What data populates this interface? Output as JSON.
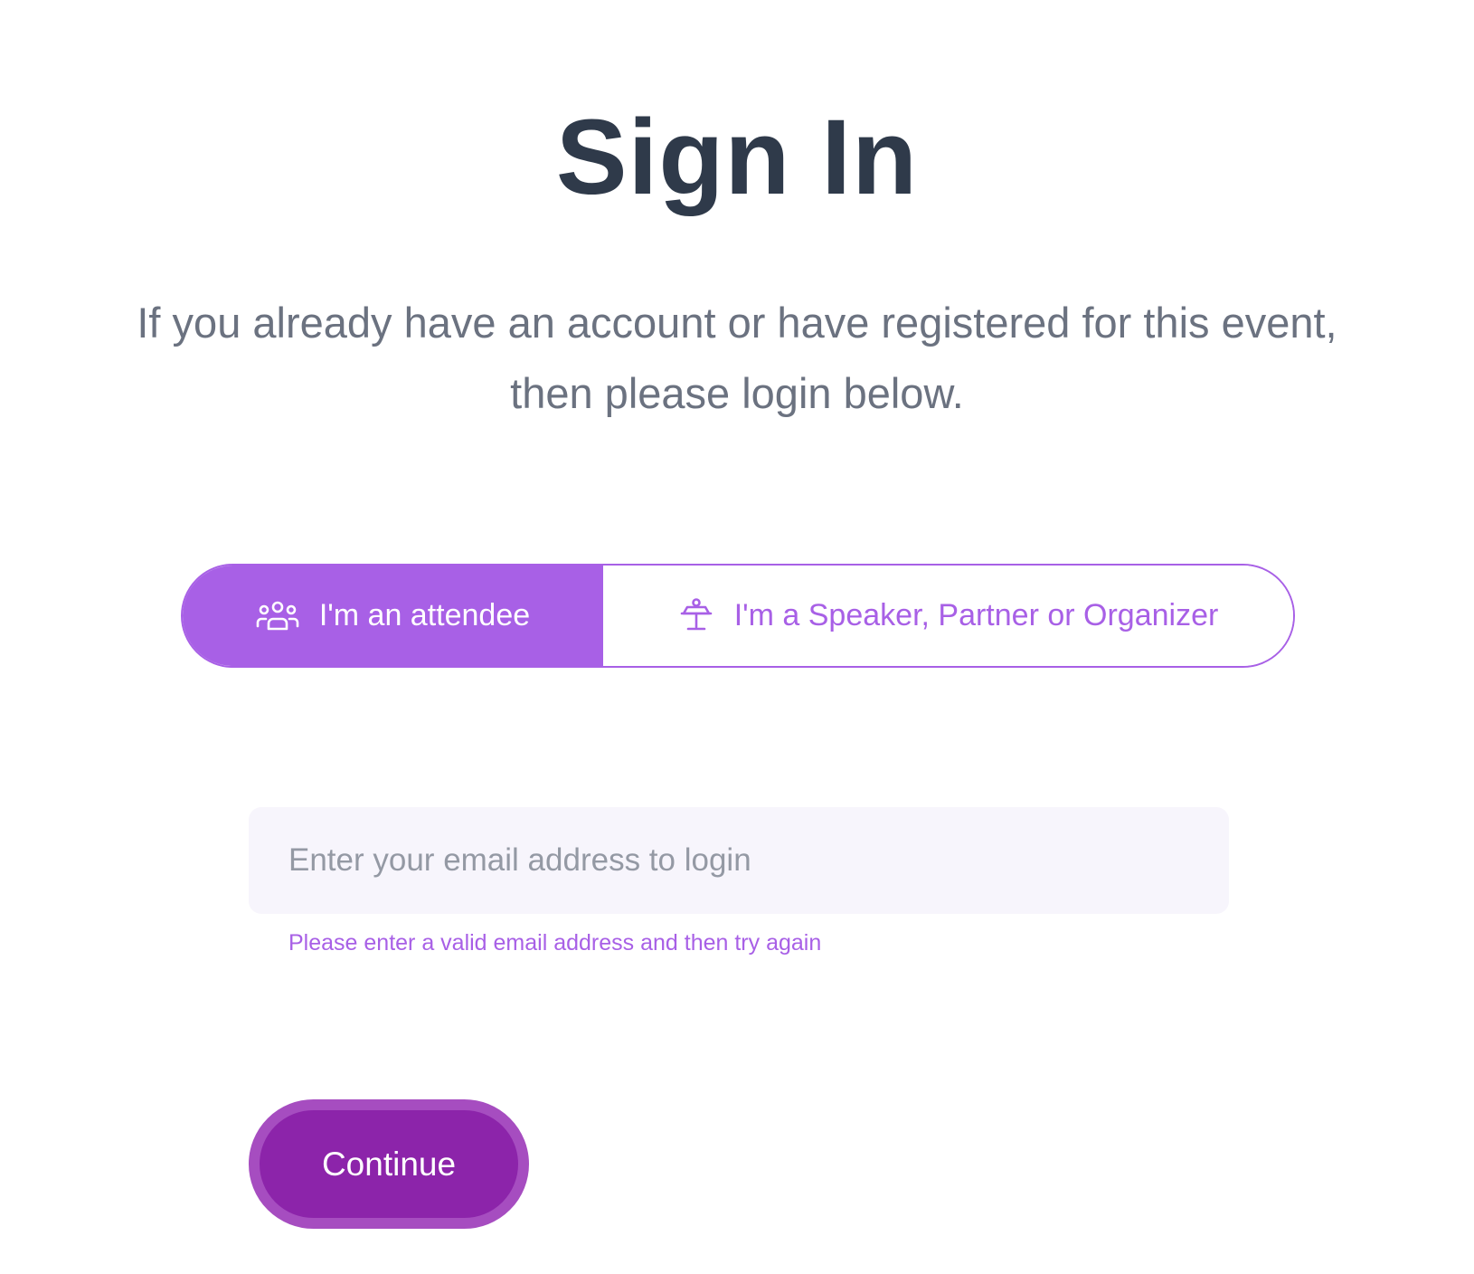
{
  "page": {
    "title": "Sign In",
    "subtitle_line1": "If you already have an account or have registered for this event,",
    "subtitle_line2": "then please login below."
  },
  "role_toggle": {
    "selected": "attendee",
    "attendee": {
      "label": "I'm an attendee",
      "icon": "users-icon"
    },
    "speaker": {
      "label": "I'm a Speaker, Partner or Organizer",
      "icon": "podium-icon"
    }
  },
  "login": {
    "email_placeholder": "Enter your email address to login",
    "email_value": "",
    "error_message": "Please enter a valid email address and then try again",
    "continue_label": "Continue"
  },
  "colors": {
    "accent": "#a860e6",
    "button": "#8c24aa",
    "title": "#2f3a4a",
    "subtitle": "#6b7280",
    "input_bg": "#f7f5fc"
  }
}
